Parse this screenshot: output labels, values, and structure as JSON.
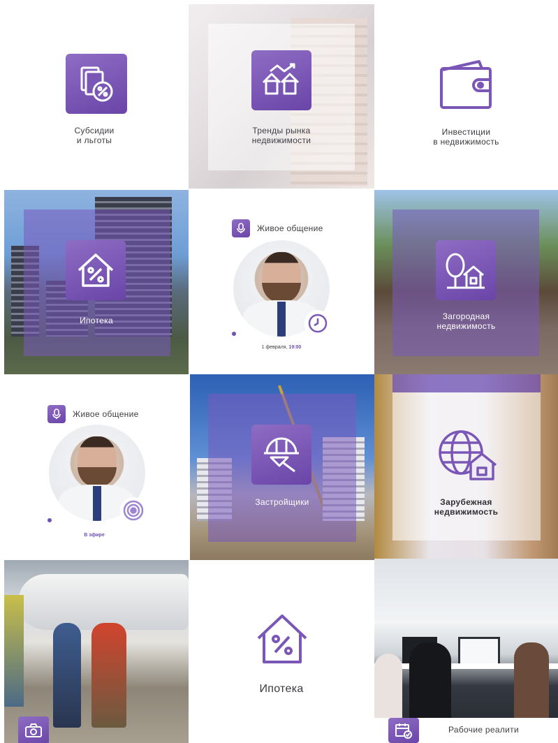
{
  "tiles": {
    "subsidies": {
      "line1": "Субсидии",
      "line2": "и льготы",
      "icon": "document-percent-icon"
    },
    "trends": {
      "line1": "Тренды рынка",
      "line2": "недвижимости",
      "icon": "houses-chart-icon"
    },
    "invest": {
      "line1": "Инвестиции",
      "line2": "в недвижимость",
      "icon": "wallet-icon"
    },
    "mortgage_photo": {
      "label": "Ипотека",
      "icon": "house-percent-icon"
    },
    "live1": {
      "title": "Живое общение",
      "date_prefix": "1 февраля, ",
      "time": "19:00",
      "icon": "microphone-icon",
      "badge_icon": "clock-icon"
    },
    "country": {
      "line1": "Загородная",
      "line2": "недвижимость",
      "icon": "tree-house-icon"
    },
    "live2": {
      "title": "Живое общение",
      "status": "В эфире",
      "icon": "microphone-icon",
      "badge_icon": "broadcast-icon"
    },
    "developers": {
      "label": "Застройщики",
      "icon": "helmet-trowel-icon"
    },
    "abroad": {
      "line1": "Зарубежная",
      "line2": "недвижимость",
      "icon": "globe-house-icon"
    },
    "travel": {
      "icon": "camera-icon"
    },
    "mortgage_plain": {
      "label": "Ипотека",
      "icon": "house-percent-icon"
    },
    "work": {
      "label": "Рабочие реалити",
      "icon": "calendar-check-icon"
    }
  },
  "colors": {
    "accent": "#6f52b3",
    "accent_light": "#8e6dc4",
    "text": "#3d3d44"
  }
}
